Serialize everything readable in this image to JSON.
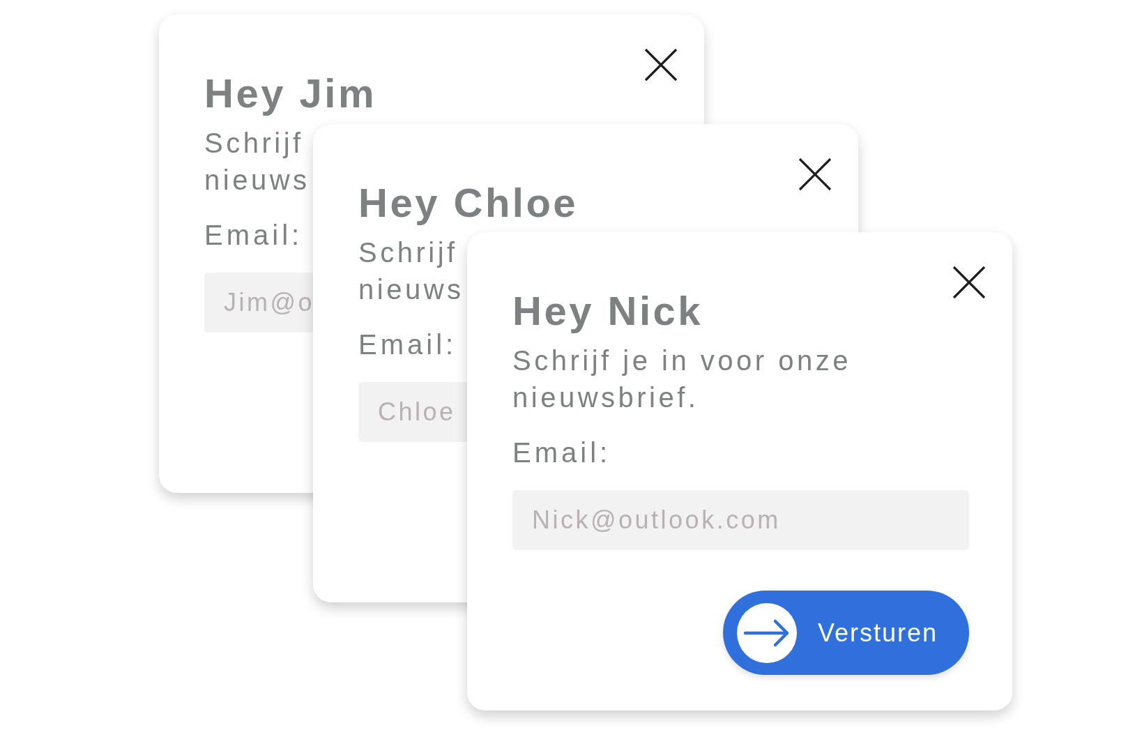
{
  "dialogs": [
    {
      "title": "Hey Jim",
      "subtitle_lines": [
        "Schrijf",
        "nieuws"
      ],
      "email_label": "Email:",
      "email_placeholder": "Jim@o"
    },
    {
      "title": "Hey Chloe",
      "subtitle_lines": [
        "Schrijf",
        "nieuws"
      ],
      "email_label": "Email:",
      "email_placeholder": "Chloe"
    },
    {
      "title": "Hey Nick",
      "subtitle_lines": [
        "Schrijf je in voor onze",
        "nieuwsbrief."
      ],
      "email_label": "Email:",
      "email_placeholder": "Nick@outlook.com",
      "button": {
        "label": "Versturen"
      }
    }
  ]
}
